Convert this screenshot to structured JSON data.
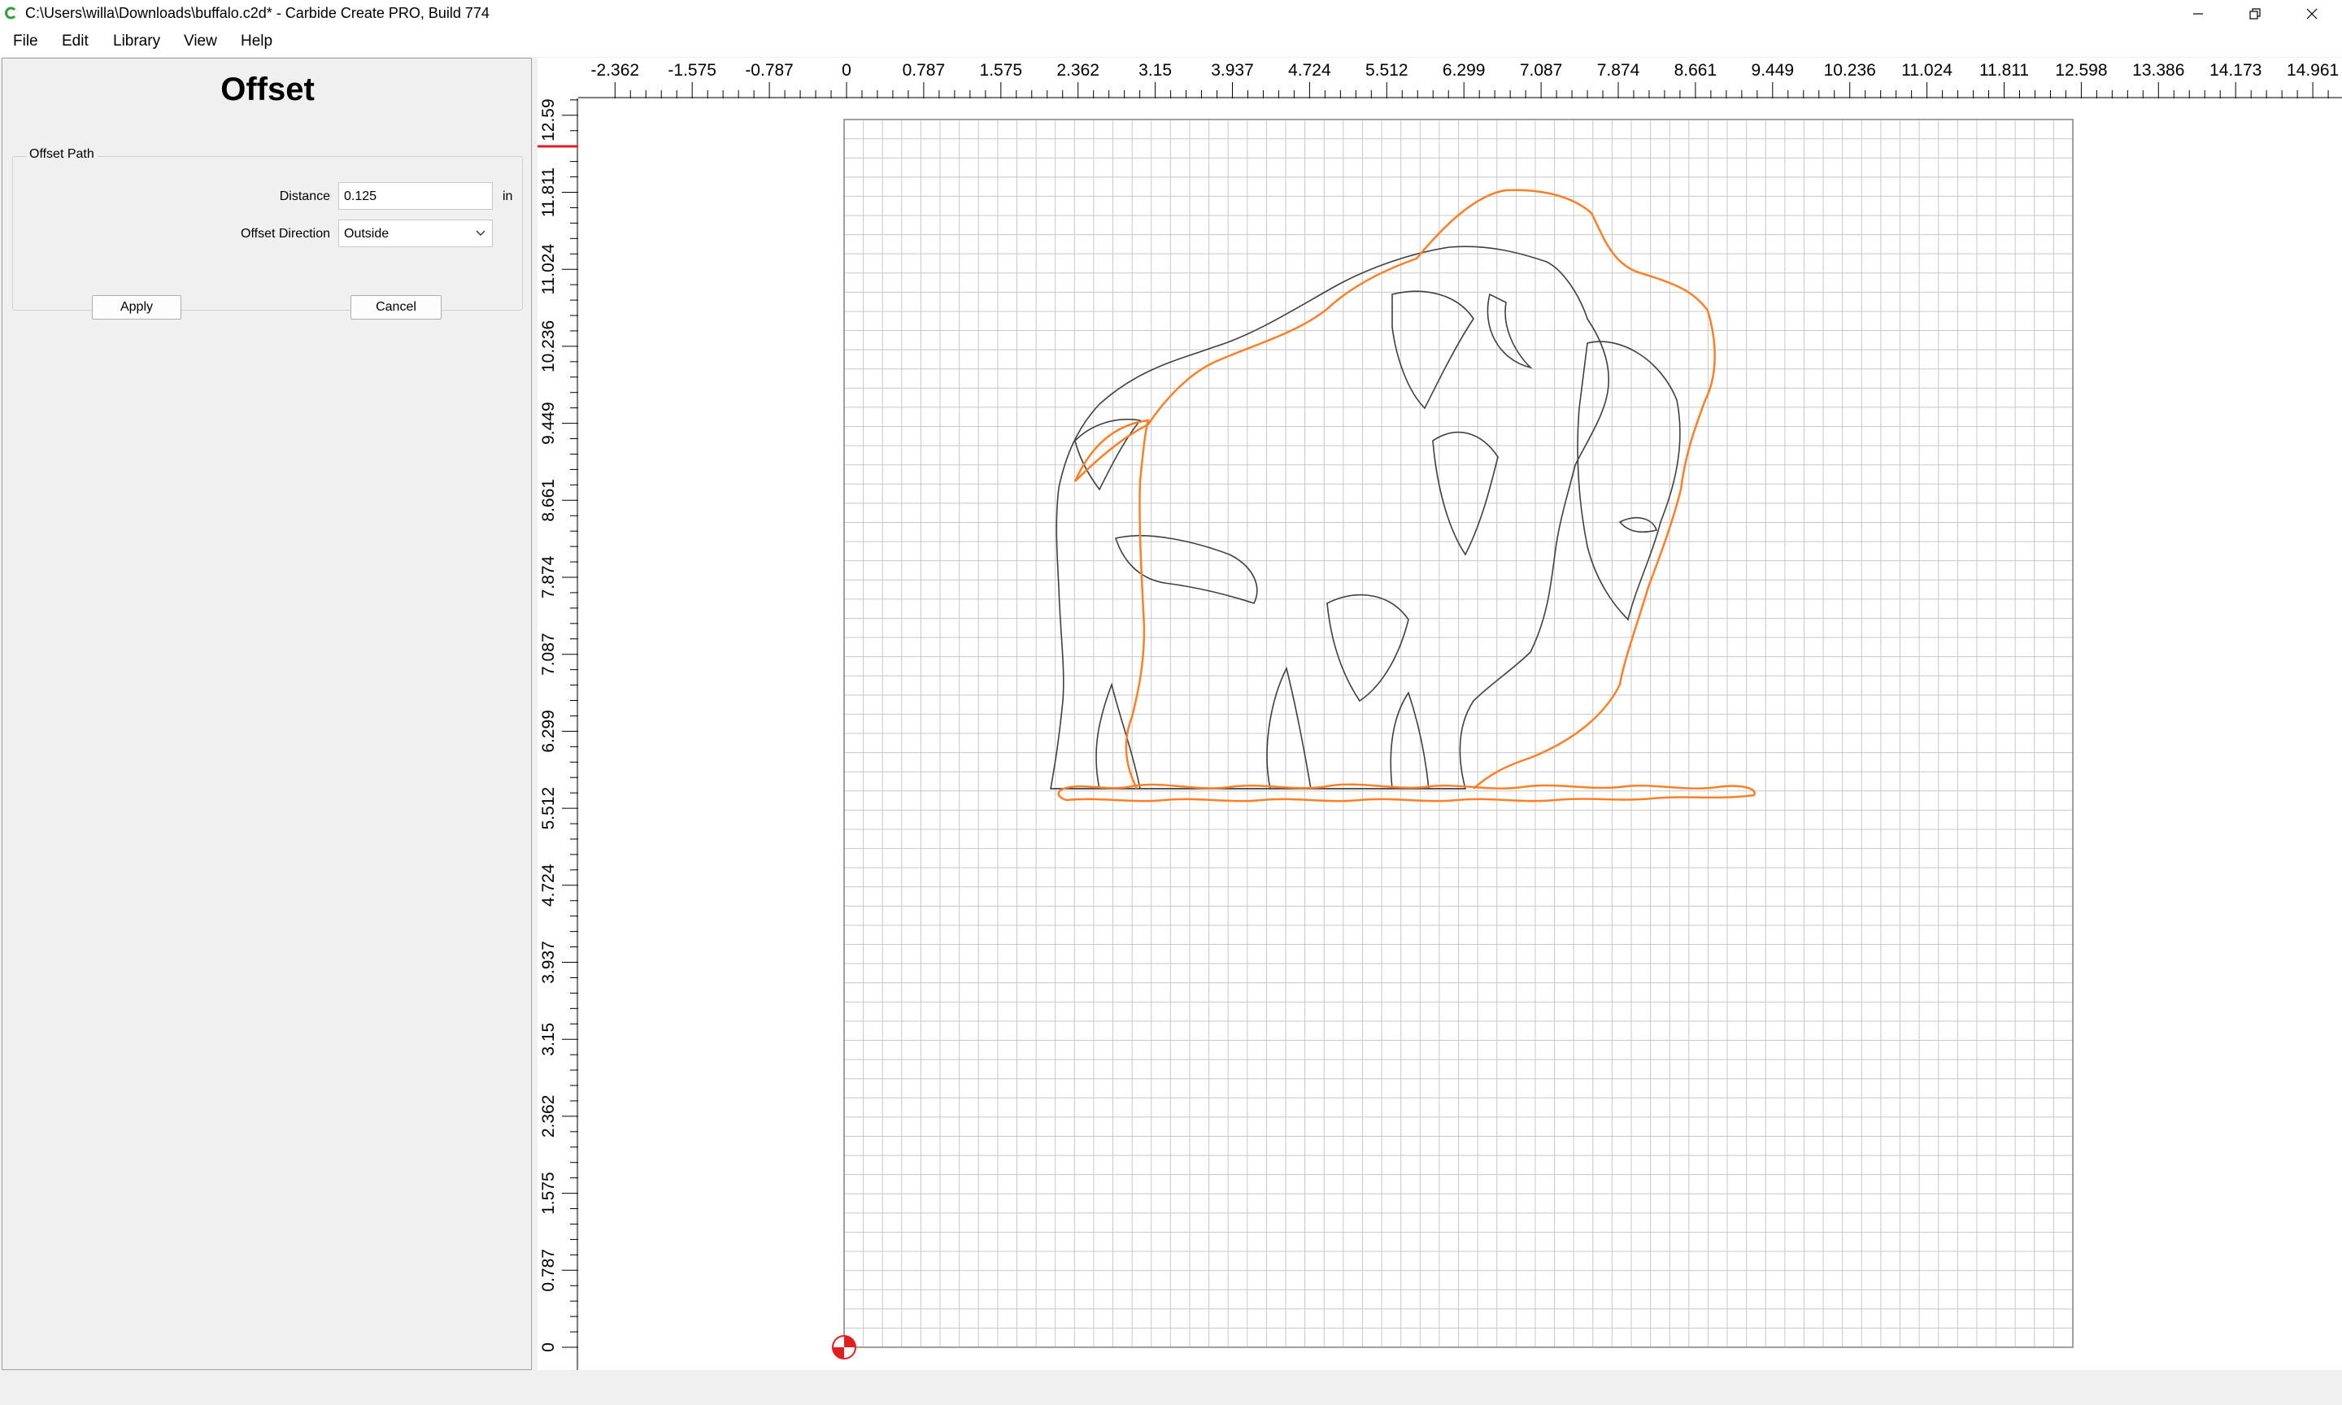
{
  "window": {
    "title": "C:\\Users\\willa\\Downloads\\buffalo.c2d* - Carbide Create PRO, Build 774"
  },
  "menu": {
    "file_label": "File",
    "edit_label": "Edit",
    "library_label": "Library",
    "view_label": "View",
    "help_label": "Help"
  },
  "panel": {
    "title": "Offset",
    "group_title": "Offset Path",
    "distance_label": "Distance",
    "distance_value": "0.125",
    "distance_unit": "in",
    "direction_label": "Offset Direction",
    "direction_value": "Outside",
    "apply_label": "Apply",
    "cancel_label": "Cancel"
  },
  "ruler": {
    "x_labels": [
      "-2.362",
      "-1.575",
      "-0.787",
      "0",
      "0.787",
      "1.575",
      "2.362",
      "3.15",
      "3.937",
      "4.724",
      "5.512",
      "6.299",
      "7.087",
      "7.874",
      "8.661",
      "9.449",
      "10.236",
      "11.024",
      "11.811",
      "12.598",
      "13.386",
      "14.173",
      "14.961"
    ],
    "y_labels": [
      "12.598",
      "11.811",
      "11.024",
      "10.236",
      "9.449",
      "8.661",
      "7.874",
      "7.087",
      "6.299",
      "5.512",
      "4.724",
      "3.937",
      "3.15",
      "2.362",
      "1.575",
      "0.787",
      "0"
    ]
  },
  "colors": {
    "selected_path": "#ff7f27",
    "path": "#404040",
    "grid": "#c8c8c8",
    "origin_marker": "#e02020"
  },
  "icons": {
    "app": "carbide-create-logo-icon",
    "minimize": "minimize-icon",
    "restore": "restore-icon",
    "close": "close-icon",
    "dropdown": "chevron-down-icon",
    "origin": "origin-marker-icon"
  }
}
